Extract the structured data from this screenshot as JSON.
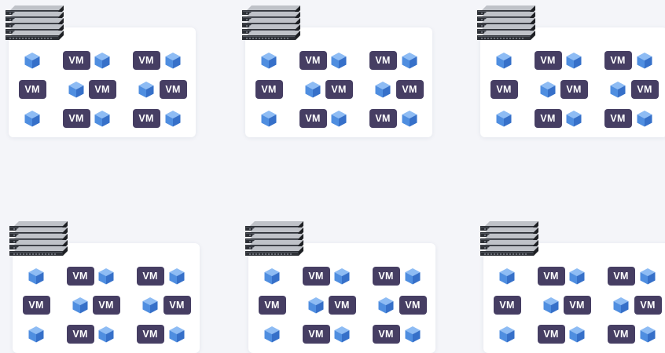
{
  "diagram": {
    "vm_label": "VM",
    "icons": {
      "server": "rack-server-icon",
      "container": "cube-icon"
    },
    "colors": {
      "background": "#f4f5f9",
      "card": "#ffffff",
      "vm_badge": "#463e63",
      "cube_top": "#8ebcf4",
      "cube_left": "#4f8ee0",
      "cube_right": "#3670c9"
    },
    "hosts": [
      {
        "rows": [
          [
            "cube",
            "vm",
            "cube",
            "vm",
            "cube"
          ],
          [
            "vm",
            "cube",
            "vm",
            "cube",
            "vm"
          ],
          [
            "cube",
            "vm",
            "cube",
            "vm",
            "cube"
          ]
        ]
      },
      {
        "rows": [
          [
            "cube",
            "vm",
            "cube",
            "vm",
            "cube"
          ],
          [
            "vm",
            "cube",
            "vm",
            "cube",
            "vm"
          ],
          [
            "cube",
            "vm",
            "cube",
            "vm",
            "cube"
          ]
        ]
      },
      {
        "rows": [
          [
            "cube",
            "vm",
            "cube",
            "vm",
            "cube"
          ],
          [
            "vm",
            "cube",
            "vm",
            "cube",
            "vm"
          ],
          [
            "cube",
            "vm",
            "cube",
            "vm",
            "cube"
          ]
        ]
      },
      {
        "rows": [
          [
            "cube",
            "vm",
            "cube",
            "vm",
            "cube"
          ],
          [
            "vm",
            "cube",
            "vm",
            "cube",
            "vm"
          ],
          [
            "cube",
            "vm",
            "cube",
            "vm",
            "cube"
          ]
        ]
      },
      {
        "rows": [
          [
            "cube",
            "vm",
            "cube",
            "vm",
            "cube"
          ],
          [
            "vm",
            "cube",
            "vm",
            "cube",
            "vm"
          ],
          [
            "cube",
            "vm",
            "cube",
            "vm",
            "cube"
          ]
        ]
      },
      {
        "rows": [
          [
            "cube",
            "vm",
            "cube",
            "vm",
            "cube"
          ],
          [
            "vm",
            "cube",
            "vm",
            "cube",
            "vm"
          ],
          [
            "cube",
            "vm",
            "cube",
            "vm",
            "cube"
          ]
        ]
      }
    ]
  }
}
